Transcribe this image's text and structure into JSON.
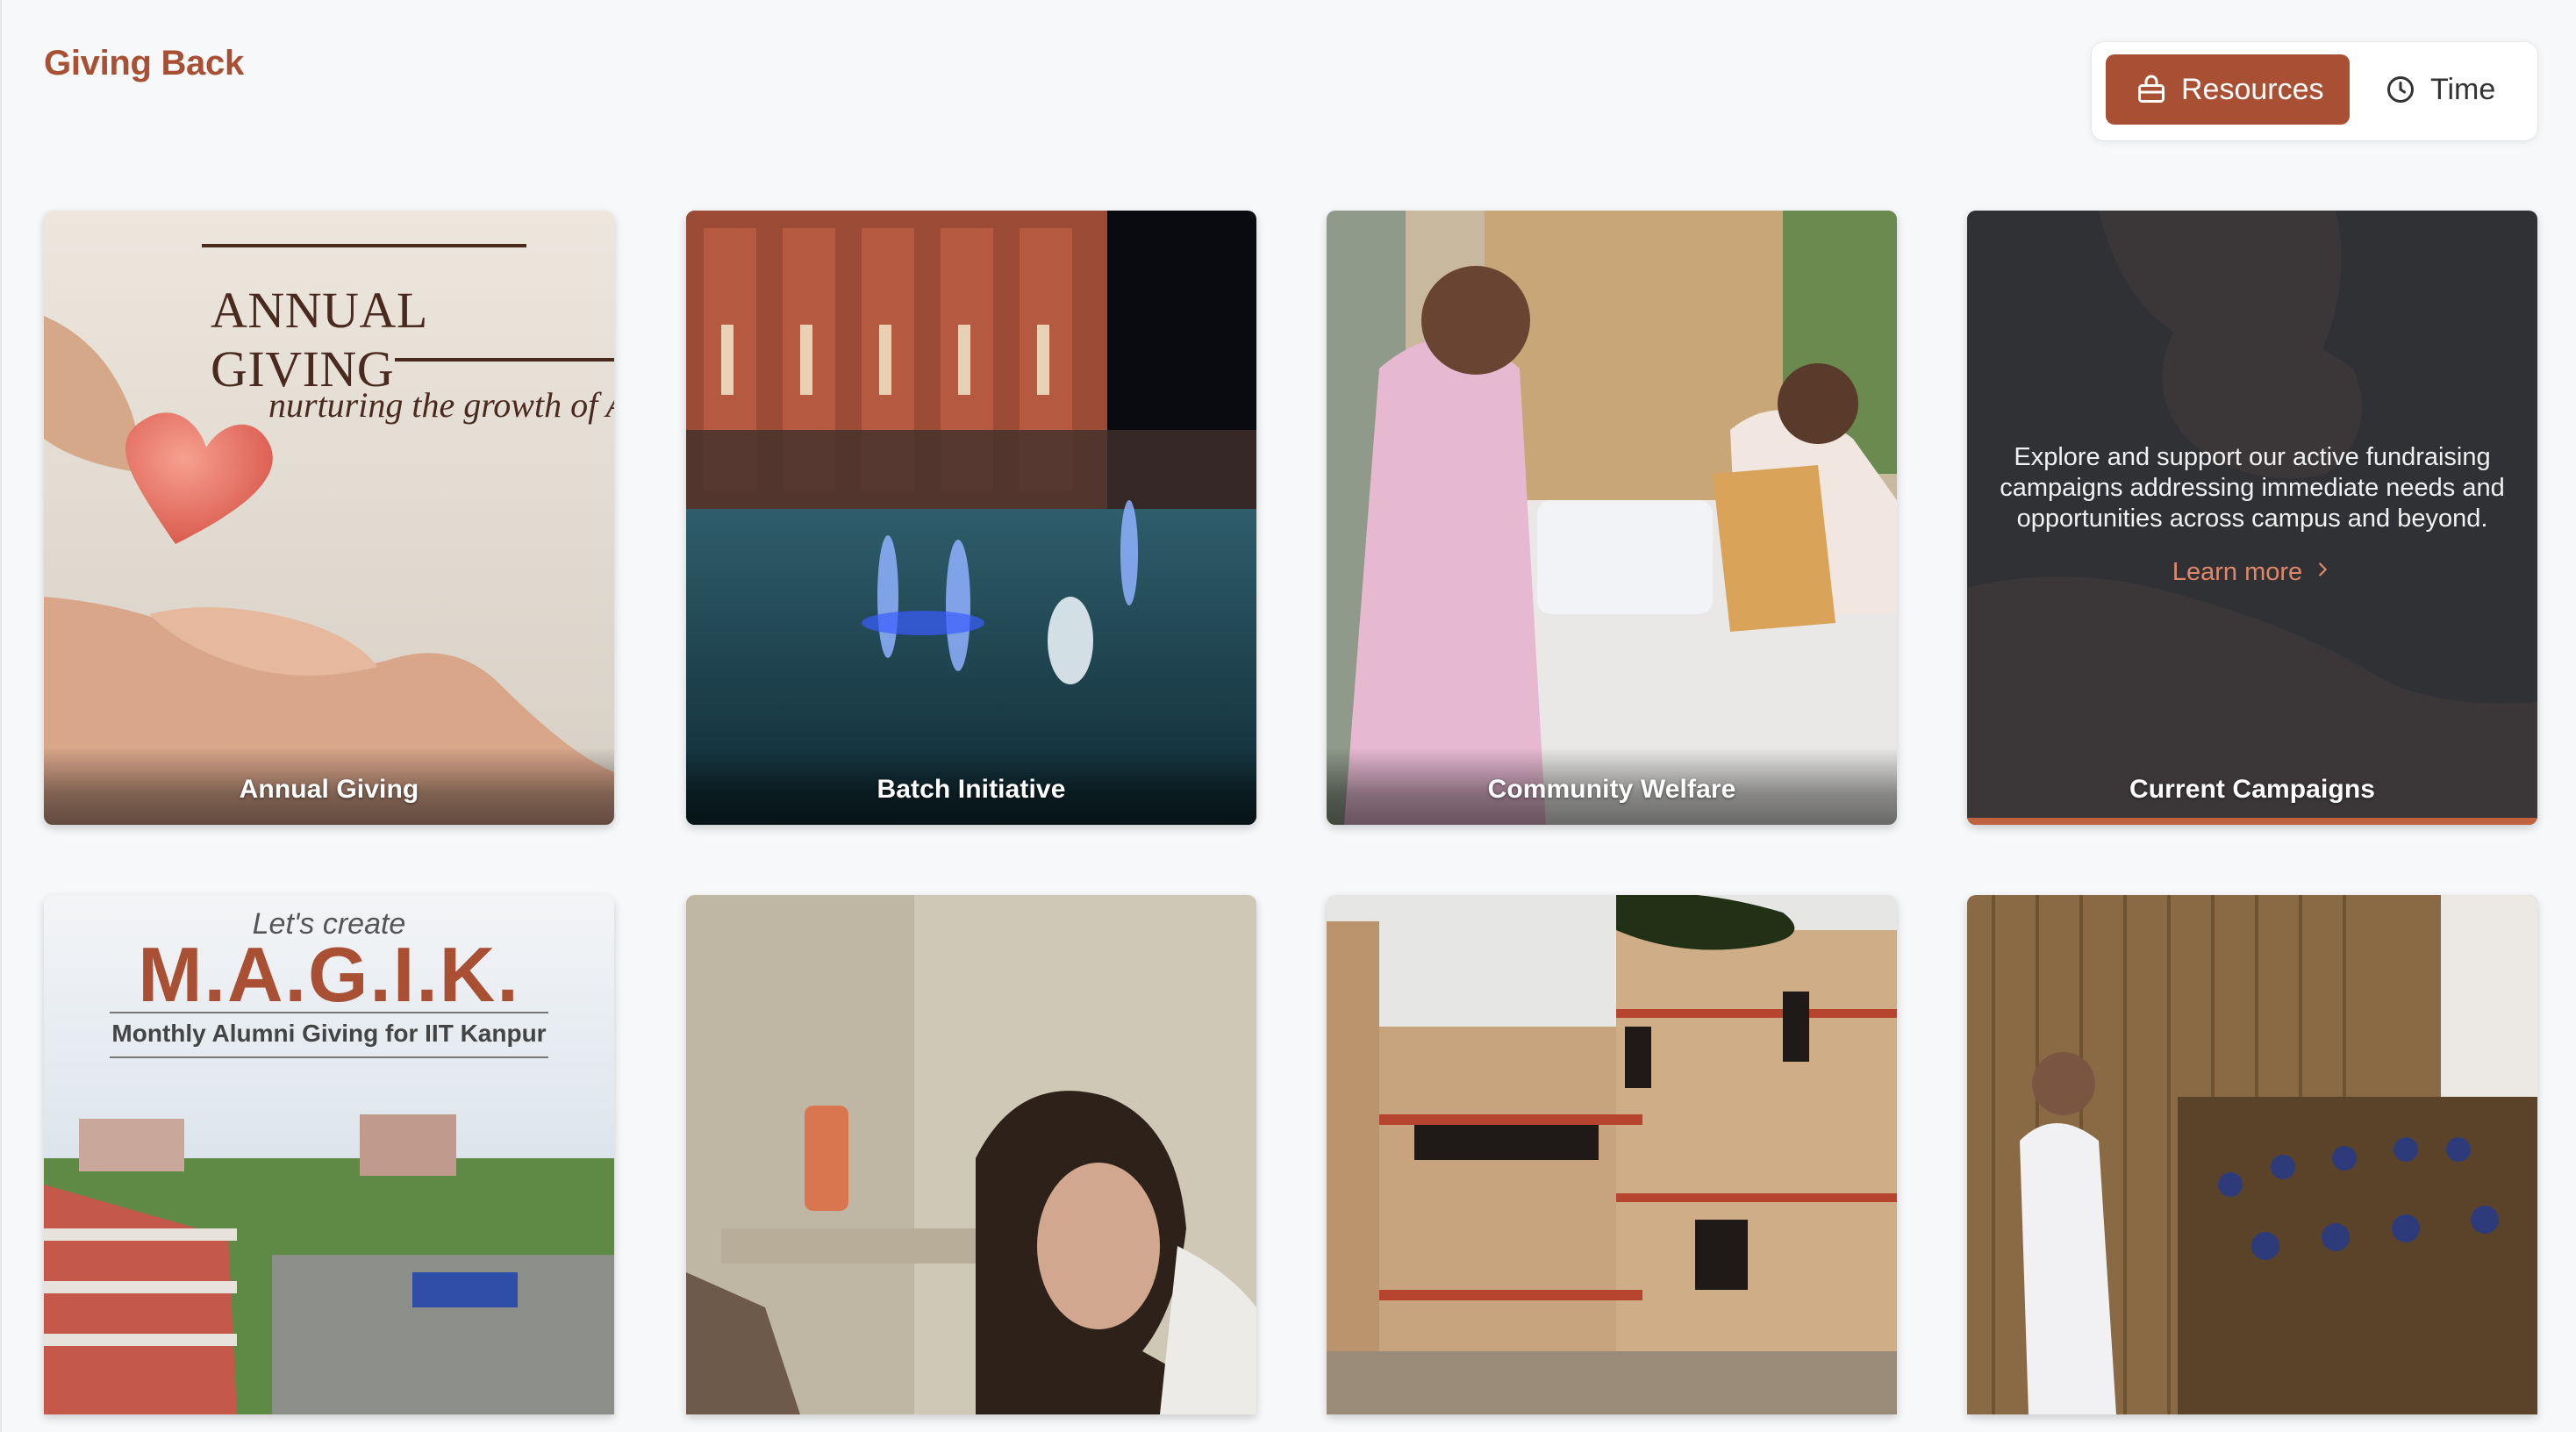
{
  "header": {
    "title": "Giving Back"
  },
  "view_toggle": {
    "resources_label": "Resources",
    "time_label": "Time",
    "active": "Resources"
  },
  "cards": [
    {
      "label": "Annual Giving",
      "art_title": "ANNUAL GIVING",
      "art_subtitle": "nurturing the growth of A"
    },
    {
      "label": "Batch Initiative"
    },
    {
      "label": "Community Welfare"
    },
    {
      "label": "Current Campaigns",
      "description": "Explore and support our active fundraising campaigns addressing immediate needs and opportunities across campus and beyond.",
      "link_label": "Learn more"
    },
    {
      "label": "",
      "art_pretitle": "Let's create",
      "art_title": "M.A.G.I.K.",
      "art_subtitle": "Monthly Alumni Giving for IIT Kanpur"
    },
    {
      "label": ""
    },
    {
      "label": ""
    },
    {
      "label": ""
    }
  ],
  "colors": {
    "brand": "#a94f33",
    "link": "#e0876a",
    "page_bg": "#f7f8fa"
  }
}
